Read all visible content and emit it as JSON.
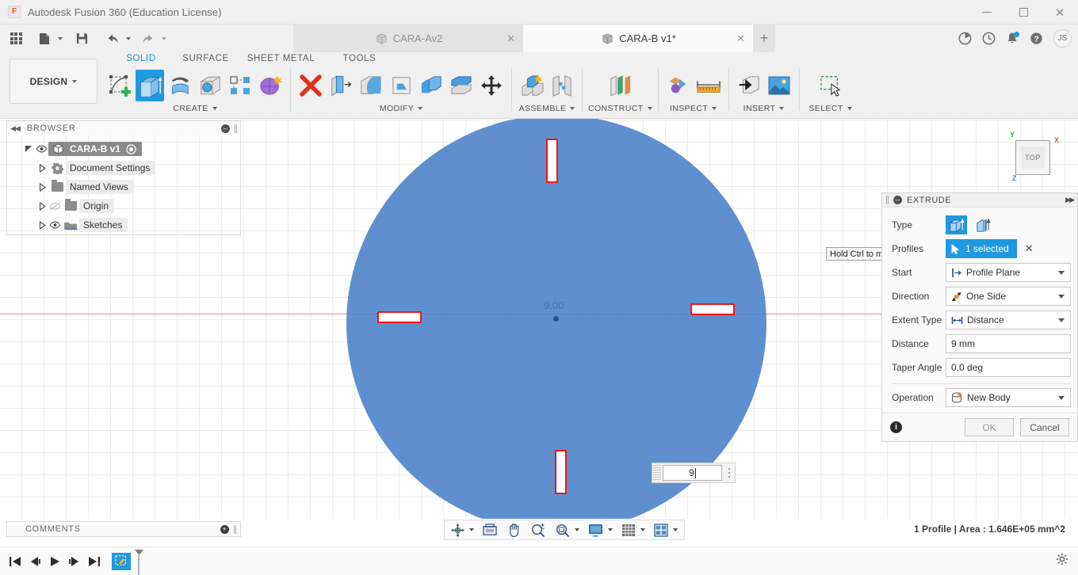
{
  "window": {
    "app_title": "Autodesk Fusion 360 (Education License)",
    "logo_text": "F",
    "minimize": "—",
    "maximize": "□",
    "close": "✕"
  },
  "quick_access": {
    "items": [
      {
        "name": "app-grid-icon",
        "label": ""
      },
      {
        "name": "new-file-icon",
        "label": ""
      },
      {
        "name": "save-icon",
        "label": ""
      },
      {
        "name": "undo-icon",
        "label": ""
      },
      {
        "name": "redo-icon",
        "label": ""
      }
    ]
  },
  "tabs": [
    {
      "label": "CARA-Av2",
      "active": false,
      "close": "✕"
    },
    {
      "label": "CARA-B v1*",
      "active": true,
      "close": "✕"
    }
  ],
  "tab_new_label": "+",
  "top_right_icons": [
    {
      "name": "job-status-icon"
    },
    {
      "name": "recent-activity-icon"
    },
    {
      "name": "notifications-icon"
    },
    {
      "name": "help-icon"
    }
  ],
  "avatar_initials": "JS",
  "ribbon": {
    "workspace_label": "DESIGN",
    "tabs": [
      {
        "label": "SOLID",
        "selected": true
      },
      {
        "label": "SURFACE",
        "selected": false
      },
      {
        "label": "SHEET METAL",
        "selected": false
      },
      {
        "label": "TOOLS",
        "selected": false
      }
    ],
    "groups": [
      {
        "label": "CREATE",
        "has_caret": true,
        "buttons": [
          {
            "name": "create-sketch-button",
            "selected": false
          },
          {
            "name": "extrude-button",
            "selected": true
          },
          {
            "name": "revolve-button",
            "selected": false
          },
          {
            "name": "hole-button",
            "selected": false
          },
          {
            "name": "rectangular-pattern-button",
            "selected": false
          },
          {
            "name": "create-form-button",
            "selected": false
          }
        ]
      },
      {
        "label": "MODIFY",
        "has_caret": true,
        "buttons": [
          {
            "name": "press-pull-button",
            "selected": false
          },
          {
            "name": "fillet-button",
            "selected": false
          },
          {
            "name": "shell-button",
            "selected": false
          },
          {
            "name": "draft-button",
            "selected": false
          },
          {
            "name": "combine-button",
            "selected": false
          },
          {
            "name": "split-face-button",
            "selected": false
          },
          {
            "name": "move-copy-button",
            "selected": false
          }
        ]
      },
      {
        "label": "ASSEMBLE",
        "has_caret": true,
        "buttons": [
          {
            "name": "new-component-button",
            "selected": false
          },
          {
            "name": "joint-button",
            "selected": false
          }
        ]
      },
      {
        "label": "CONSTRUCT",
        "has_caret": true,
        "buttons": [
          {
            "name": "offset-plane-button",
            "selected": false
          }
        ]
      },
      {
        "label": "INSPECT",
        "has_caret": true,
        "buttons": [
          {
            "name": "section-analysis-button",
            "selected": false
          },
          {
            "name": "measure-button",
            "selected": false
          }
        ]
      },
      {
        "label": "INSERT",
        "has_caret": true,
        "buttons": [
          {
            "name": "insert-derive-button",
            "selected": false
          },
          {
            "name": "canvas-image-button",
            "selected": false
          }
        ]
      },
      {
        "label": "SELECT",
        "has_caret": true,
        "buttons": [
          {
            "name": "select-window-button",
            "selected": false
          }
        ]
      }
    ]
  },
  "browser": {
    "title": "BROWSER",
    "collapse_glyph": "◀◀",
    "minimize_glyph": "—",
    "nodes": [
      {
        "label": "CARA-B v1",
        "indent": 0,
        "selected": true,
        "eye": true,
        "icon": "component-icon",
        "has_radio": true
      },
      {
        "label": "Document Settings",
        "indent": 1,
        "selected": false,
        "eye": false,
        "icon": "gear-icon"
      },
      {
        "label": "Named Views",
        "indent": 1,
        "selected": false,
        "eye": false,
        "icon": "folder-icon"
      },
      {
        "label": "Origin",
        "indent": 1,
        "selected": false,
        "eye": "off",
        "icon": "folder-icon"
      },
      {
        "label": "Sketches",
        "indent": 1,
        "selected": false,
        "eye": true,
        "icon": "sketch-folder-icon"
      }
    ]
  },
  "canvas": {
    "dimension_label": "9.00",
    "viewcube_face": "TOP",
    "axes": [
      {
        "name": "y-axis-label",
        "label": "Y",
        "color": "#3fa34d"
      },
      {
        "name": "x-axis-label",
        "label": "X",
        "color": "#e05252"
      },
      {
        "name": "z-axis-label",
        "label": "Z",
        "color": "#4a6fe0"
      }
    ],
    "disc_color": "#4a7fc8",
    "slot_outline_color": "#ef1414",
    "inline_edit": {
      "value": "9",
      "name": "distance-inline-input"
    }
  },
  "extrude": {
    "title": "EXTRUDE",
    "collapse_glyph": "—",
    "expand_glyph": "▶▶",
    "rows": [
      {
        "label": "Type",
        "kind": "type-toggle"
      },
      {
        "label": "Profiles",
        "kind": "selection",
        "value": "1 selected",
        "clear": "✕"
      },
      {
        "label": "Start",
        "kind": "dropdown",
        "value": "Profile Plane"
      },
      {
        "label": "Direction",
        "kind": "dropdown",
        "value": "One Side"
      },
      {
        "label": "Extent Type",
        "kind": "dropdown",
        "value": "Distance"
      },
      {
        "label": "Distance",
        "kind": "input",
        "value": "9 mm"
      },
      {
        "label": "Taper Angle",
        "kind": "input",
        "value": "0.0 deg"
      },
      {
        "label": "Operation",
        "kind": "dropdown",
        "value": "New Body"
      }
    ],
    "ok_label": "OK",
    "cancel_label": "Cancel",
    "info_glyph": "i"
  },
  "tooltip": {
    "text": "Hold Ctrl to modify selection"
  },
  "navbar": {
    "items": [
      {
        "name": "orbit-button",
        "caret": true
      },
      {
        "name": "look-at-button",
        "caret": false
      },
      {
        "name": "pan-button",
        "caret": false
      },
      {
        "name": "zoom-button",
        "caret": false
      },
      {
        "name": "zoom-window-button",
        "caret": true
      },
      {
        "name": "display-settings-button",
        "caret": true
      },
      {
        "name": "grid-snaps-button",
        "caret": true
      },
      {
        "name": "viewports-button",
        "caret": true
      }
    ]
  },
  "comments": {
    "title": "COMMENTS",
    "add_glyph": "+"
  },
  "status": {
    "text": "1 Profile | Area : 1.646E+05 mm^2"
  },
  "timeline": {
    "buttons": [
      {
        "name": "timeline-go-start-button",
        "glyph": "|◀"
      },
      {
        "name": "timeline-step-back-button",
        "glyph": "◀|"
      },
      {
        "name": "timeline-play-button",
        "glyph": "▶"
      },
      {
        "name": "timeline-step-forward-button",
        "glyph": "|▶"
      },
      {
        "name": "timeline-go-end-button",
        "glyph": "▶|"
      }
    ],
    "feature_name": "sketch-feature-node",
    "settings_name": "timeline-settings-icon"
  }
}
